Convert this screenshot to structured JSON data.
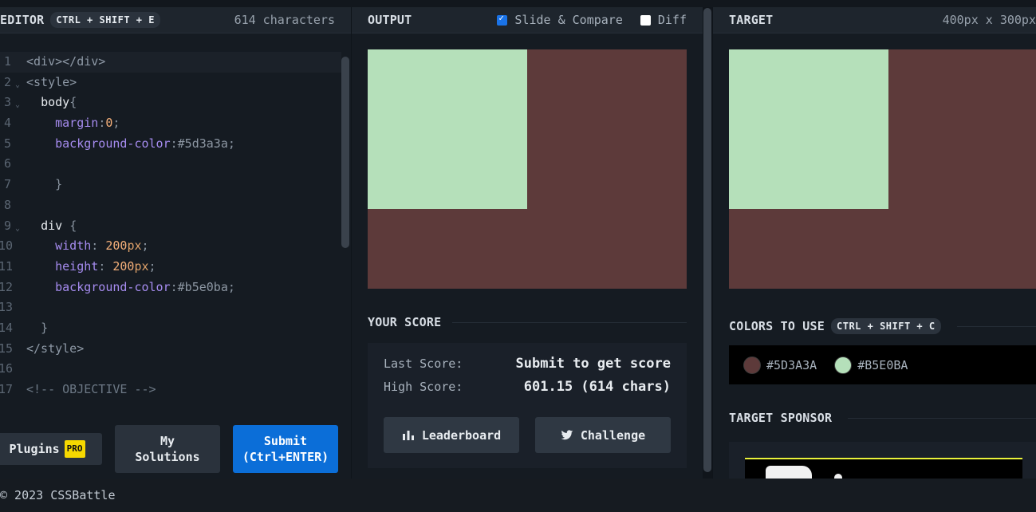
{
  "editor": {
    "title": "EDITOR",
    "shortcut": "CTRL + SHIFT + E",
    "char_count": "614 characters",
    "lines": [
      {
        "n": "1"
      },
      {
        "n": "2"
      },
      {
        "n": "3"
      },
      {
        "n": "4"
      },
      {
        "n": "5"
      },
      {
        "n": "6"
      },
      {
        "n": "7"
      },
      {
        "n": "8"
      },
      {
        "n": "9"
      },
      {
        "n": "10"
      },
      {
        "n": "11"
      },
      {
        "n": "12"
      },
      {
        "n": "13"
      },
      {
        "n": "14"
      },
      {
        "n": "15"
      },
      {
        "n": "16"
      },
      {
        "n": "17"
      }
    ],
    "code": {
      "l1_open": "<div>",
      "l1_close": "</div>",
      "l2": "<style>",
      "l3_sel": "body",
      "l3_brace": "{",
      "l4_prop": "margin",
      "l4_val": "0",
      "l5_prop": "background-color",
      "l5_val": "#5d3a3a",
      "l7": "}",
      "l9_sel": "div",
      "l9_brace": "{",
      "l10_prop": "width",
      "l10_num": "200",
      "l10_unit": "px",
      "l11_prop": "height",
      "l11_num": "200",
      "l11_unit": "px",
      "l12_prop": "background-color",
      "l12_val": "#b5e0ba",
      "l14": "}",
      "l15": "</style>",
      "l17": "<!-- OBJECTIVE -->"
    },
    "buttons": {
      "plugins": "Plugins",
      "pro": "PRO",
      "my_solutions_1": "My",
      "my_solutions_2": "Solutions",
      "submit_1": "Submit",
      "submit_2": "(Ctrl+ENTER)"
    }
  },
  "output": {
    "title": "OUTPUT",
    "slide_compare": "Slide & Compare",
    "slide_compare_checked": true,
    "diff": "Diff",
    "diff_checked": false,
    "score_title": "YOUR SCORE",
    "last_score_label": "Last Score:",
    "last_score_value": "Submit to get score",
    "high_score_label": "High Score:",
    "high_score_value": "601.15 (614 chars)",
    "leaderboard": "Leaderboard",
    "challenge": "Challenge"
  },
  "target": {
    "title": "TARGET",
    "dims": "400px x 300px",
    "colors_title": "COLORS TO USE",
    "colors_shortcut": "CTRL + SHIFT + C",
    "colors": [
      {
        "hex": "#5D3A3A",
        "color": "#5d3a3a"
      },
      {
        "hex": "#B5E0BA",
        "color": "#b5e0ba"
      }
    ],
    "sponsor_title": "TARGET SPONSOR"
  },
  "render_colors": {
    "background": "#5d3a3a",
    "square": "#b5e0ba"
  },
  "footer": {
    "copyright": "© 2023 CSSBattle"
  }
}
